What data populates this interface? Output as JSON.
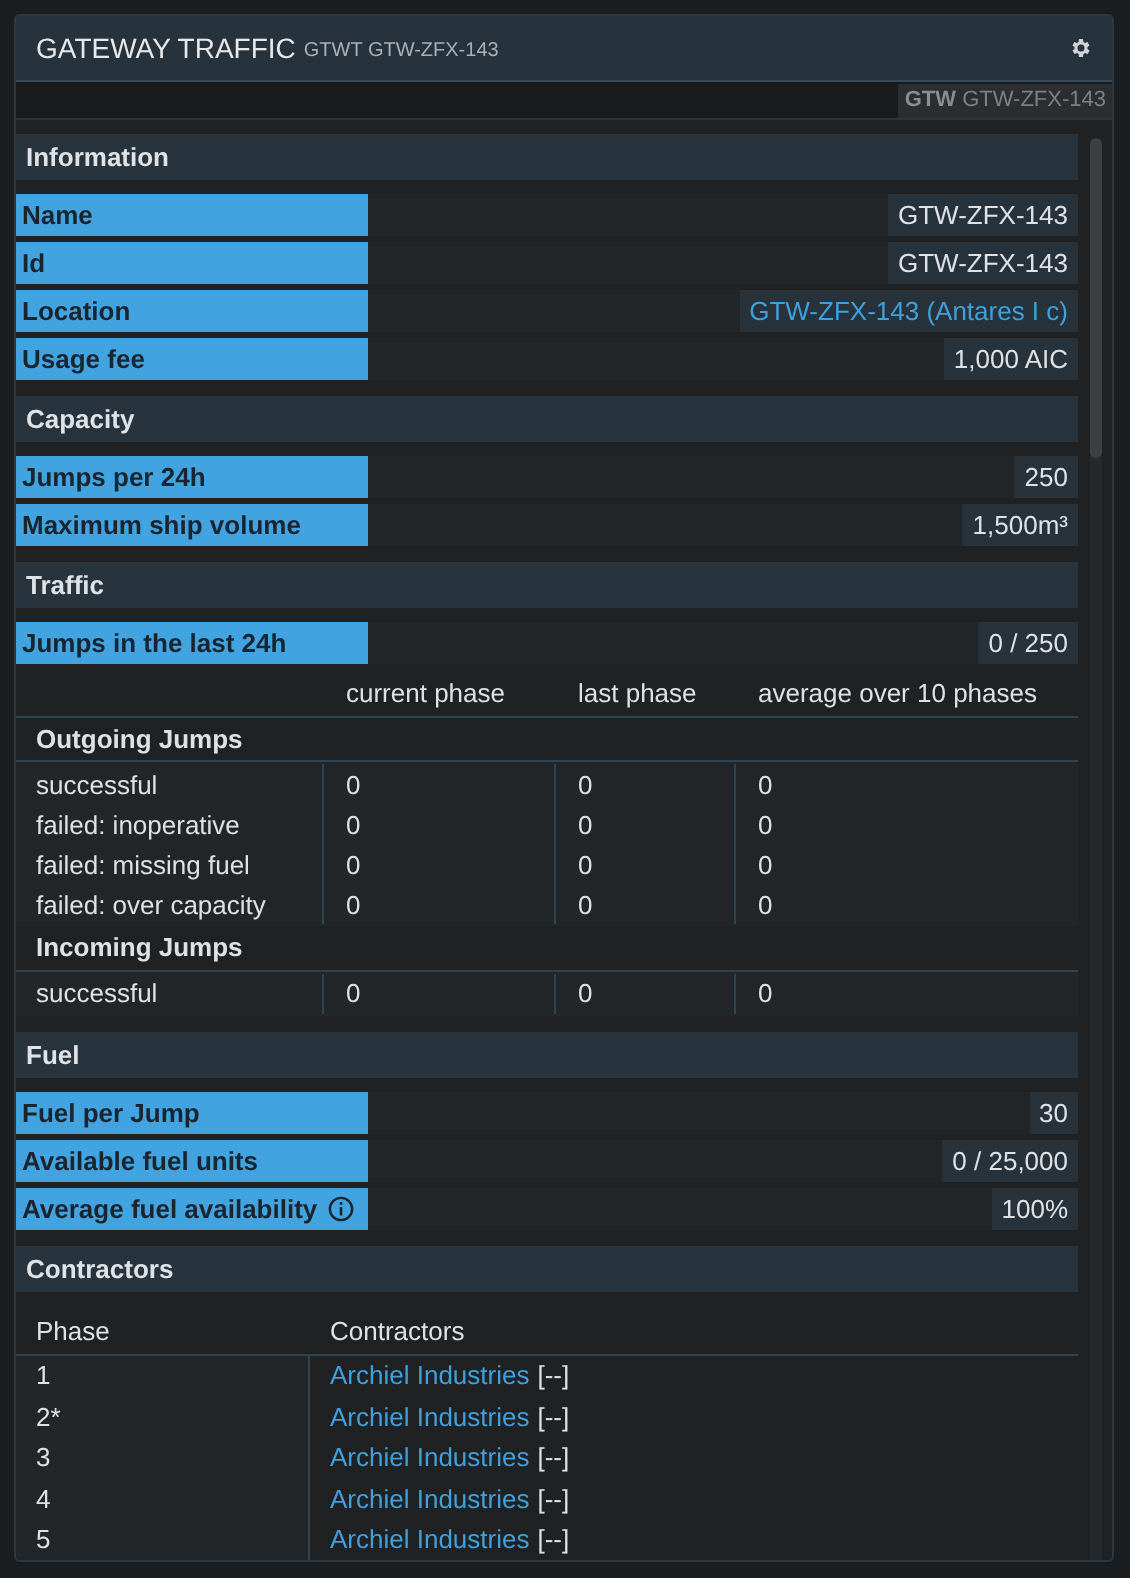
{
  "window": {
    "title": "GATEWAY TRAFFIC",
    "code": "GTWT GTW-ZFX-143"
  },
  "subbar": {
    "badge_bold": "GTW",
    "badge_text": "GTW-ZFX-143"
  },
  "sections": [
    {
      "title": "Information",
      "rows": [
        {
          "label": "Name",
          "value": "GTW-ZFX-143",
          "link": false,
          "info": false
        },
        {
          "label": "Id",
          "value": "GTW-ZFX-143",
          "link": false,
          "info": false
        },
        {
          "label": "Location",
          "value": "GTW-ZFX-143 (Antares I c)",
          "link": true,
          "info": false
        },
        {
          "label": "Usage fee",
          "value": "1,000 AIC",
          "link": false,
          "info": false
        }
      ]
    },
    {
      "title": "Capacity",
      "rows": [
        {
          "label": "Jumps per 24h",
          "value": "250",
          "link": false,
          "info": false
        },
        {
          "label": "Maximum ship volume",
          "value": "1,500m³",
          "link": false,
          "info": false
        }
      ]
    },
    {
      "title": "Traffic",
      "rows": [
        {
          "label": "Jumps in the last 24h",
          "value": "0 / 250",
          "link": false,
          "info": false
        }
      ],
      "table": {
        "columns": [
          "current phase",
          "last phase",
          "average over 10 phases"
        ],
        "groups": [
          {
            "title": "Outgoing Jumps",
            "rows": [
              {
                "label": "successful",
                "cells": [
                  "0",
                  "0",
                  "0"
                ]
              },
              {
                "label": "failed: inoperative",
                "cells": [
                  "0",
                  "0",
                  "0"
                ]
              },
              {
                "label": "failed: missing fuel",
                "cells": [
                  "0",
                  "0",
                  "0"
                ]
              },
              {
                "label": "failed: over capacity",
                "cells": [
                  "0",
                  "0",
                  "0"
                ]
              }
            ]
          },
          {
            "title": "Incoming Jumps",
            "rows": [
              {
                "label": "successful",
                "cells": [
                  "0",
                  "0",
                  "0"
                ]
              }
            ]
          }
        ]
      }
    },
    {
      "title": "Fuel",
      "rows": [
        {
          "label": "Fuel per Jump",
          "value": "30",
          "link": false,
          "info": false
        },
        {
          "label": "Available fuel units",
          "value": "0 / 25,000",
          "link": false,
          "info": false
        },
        {
          "label": "Average fuel availability",
          "value": "100%",
          "link": false,
          "info": true
        }
      ]
    },
    {
      "title": "Contractors",
      "contractors": {
        "columns": [
          "Phase",
          "Contractors"
        ],
        "rows": [
          {
            "phase": "1",
            "name": "Archiel Industries",
            "suffix": "[--]"
          },
          {
            "phase": "2*",
            "name": "Archiel Industries",
            "suffix": "[--]"
          },
          {
            "phase": "3",
            "name": "Archiel Industries",
            "suffix": "[--]"
          },
          {
            "phase": "4",
            "name": "Archiel Industries",
            "suffix": "[--]"
          },
          {
            "phase": "5",
            "name": "Archiel Industries",
            "suffix": "[--]"
          }
        ]
      }
    }
  ]
}
